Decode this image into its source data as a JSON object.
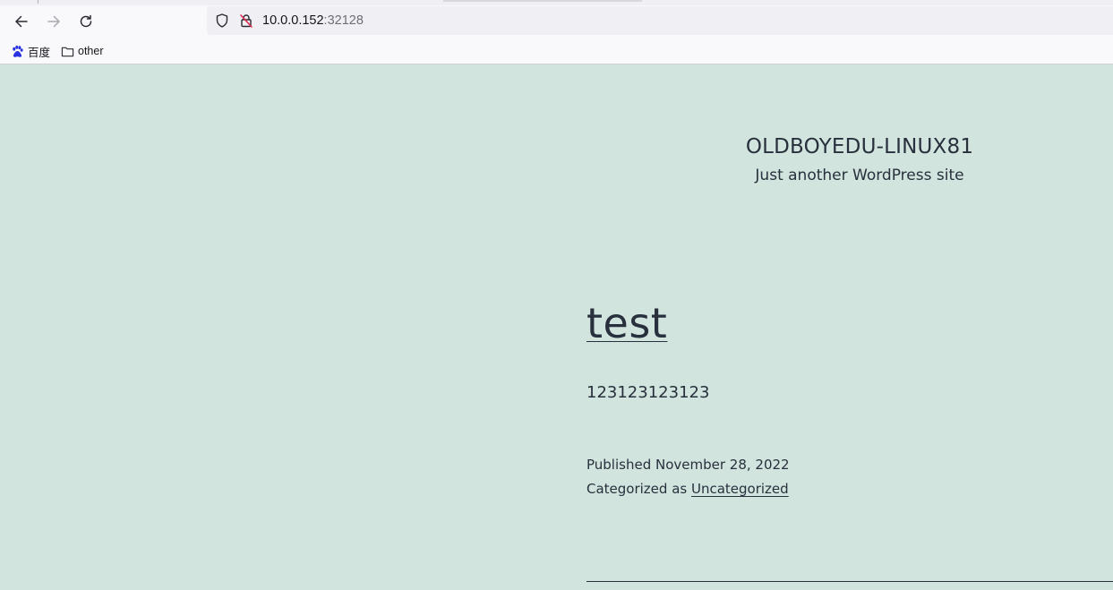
{
  "browser": {
    "url_host": "10.0.0.152",
    "url_port": ":32128",
    "bookmarks": [
      {
        "label": "百度",
        "icon": "baidu-paw-icon"
      },
      {
        "label": "other",
        "icon": "folder-icon"
      }
    ]
  },
  "site": {
    "title": "OLDBOYEDU-LINUX81",
    "tagline": "Just another WordPress site"
  },
  "post": {
    "title": "test",
    "body": "123123123123",
    "published_label": "Published November 28, 2022",
    "categorized_prefix": "Categorized as ",
    "category": "Uncategorized"
  },
  "colors": {
    "page_background": "#d1e4dd",
    "text": "#28303d",
    "chrome": "#f9f9fb"
  }
}
